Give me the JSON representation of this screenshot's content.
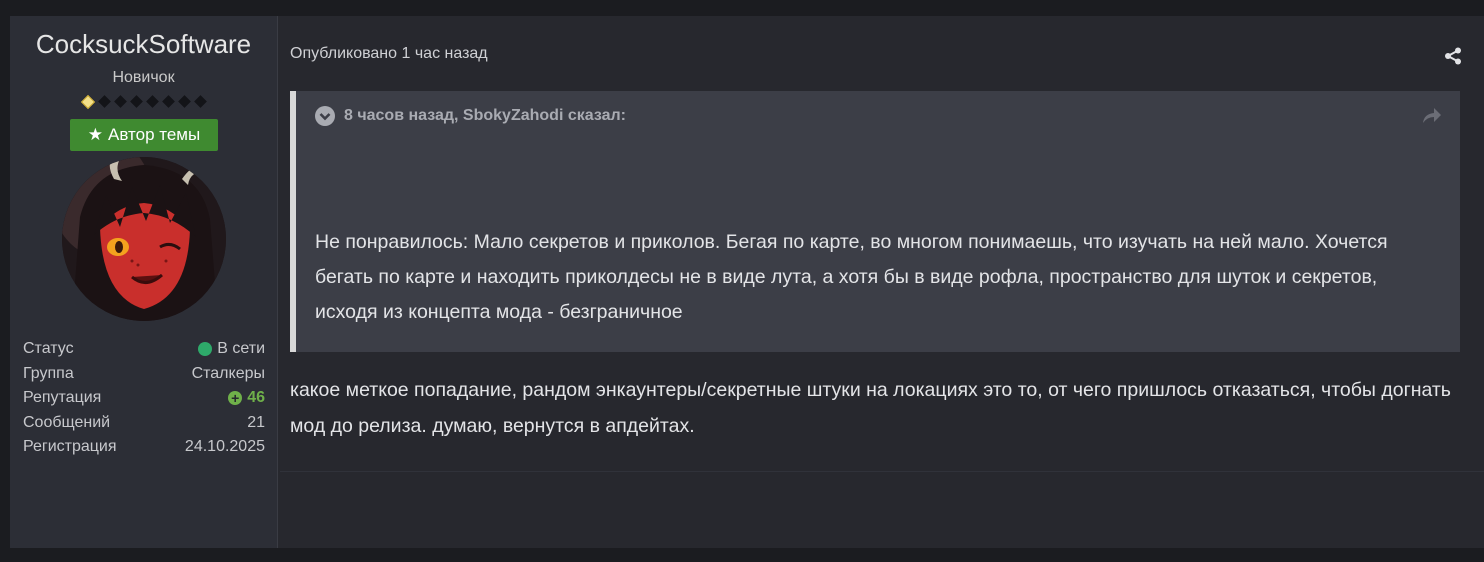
{
  "author": {
    "name": "CocksuckSoftware",
    "rank": "Новичок",
    "rank_pips": {
      "filled": 1,
      "total": 8
    },
    "starter_badge": "Автор темы",
    "stats": [
      {
        "label": "Статус",
        "value": "В сети"
      },
      {
        "label": "Группа",
        "value": "Сталкеры"
      },
      {
        "label": "Репутация",
        "value": "46"
      },
      {
        "label": "Сообщений",
        "value": "21"
      },
      {
        "label": "Регистрация",
        "value": "24.10.2025"
      }
    ]
  },
  "post": {
    "meta": "Опубликовано 1 час назад",
    "quote": {
      "header": "8 часов назад, SbokyZahodi сказал:",
      "text": "Не понравилось: Мало секретов и приколов. Бегая по карте, во многом понимаешь, что изучать на ней мало. Хочется бегать по карте и находить приколдесы не в виде лута, а хотя бы в виде рофла, пространство для шуток и секретов, исходя из концепта мода - безграничное"
    },
    "body": "какое меткое попадание, рандом энкаунтеры/секретные штуки на локациях это то, от чего пришлось отказаться, чтобы догнать мод до релиза. думаю, вернутся в апдейтах."
  },
  "colors": {
    "online": "#2eaa6a",
    "reputation": "#6fb04a",
    "starter_badge": "#3f8a30",
    "quote_border": "#d8d8d8"
  },
  "icons": {
    "share": "share-icon",
    "quote_toggle": "chevron-down-circle-icon",
    "quote_jump": "reply-arrow-icon",
    "badge": "star-icon",
    "reputation": "plus-circle-icon"
  }
}
